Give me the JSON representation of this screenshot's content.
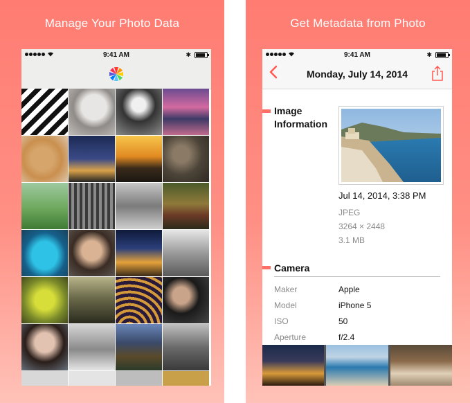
{
  "left_panel": {
    "caption": "Manage Your Photo Data",
    "status": {
      "time": "9:41 AM"
    }
  },
  "right_panel": {
    "caption": "Get Metadata from Photo",
    "status": {
      "time": "9:41 AM"
    },
    "nav": {
      "title": "Monday, July 14, 2014"
    },
    "image_section": {
      "title_line1": "Image",
      "title_line2": "Information",
      "date": "Jul 14, 2014, 3:38 PM",
      "format": "JPEG",
      "dimensions": "3264 × 2448",
      "size": "3.1 MB"
    },
    "camera_section": {
      "title": "Camera",
      "rows": [
        {
          "label": "Maker",
          "value": "Apple"
        },
        {
          "label": "Model",
          "value": "iPhone 5"
        },
        {
          "label": "ISO",
          "value": "50"
        },
        {
          "label": "Aperture",
          "value": "f/2.4"
        }
      ]
    }
  },
  "colors": {
    "accent": "#ff6f66",
    "panel_gradient_top": "#ff7c72",
    "panel_gradient_bottom": "#ffc2b8"
  }
}
